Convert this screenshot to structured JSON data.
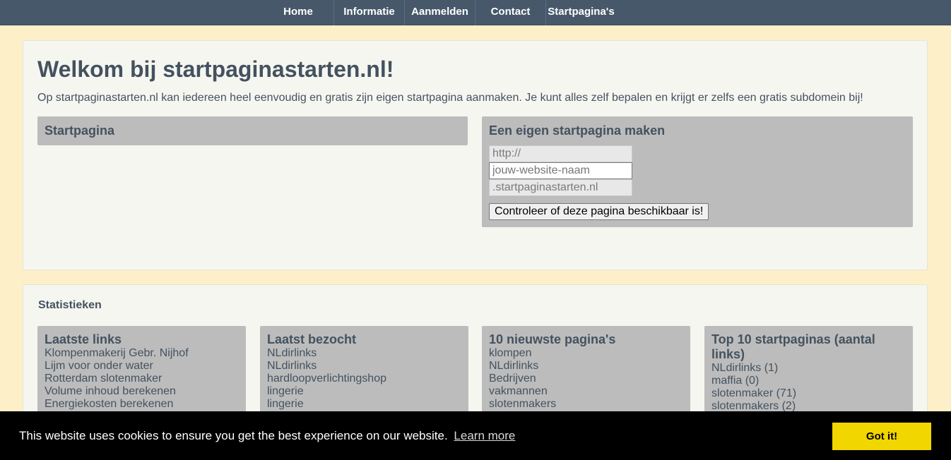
{
  "nav": {
    "items": [
      {
        "label": "Home"
      },
      {
        "label": "Informatie"
      },
      {
        "label": "Aanmelden"
      },
      {
        "label": "Contact"
      },
      {
        "label": "Startpagina's"
      }
    ]
  },
  "welcome": {
    "title": "Welkom bij startpaginastarten.nl!",
    "intro": "Op startpaginastarten.nl kan iedereen heel eenvoudig en gratis zijn eigen startpagina aanmaken. Je kunt alles zelf bepalen en krijgt er zelfs een gratis subdomein bij!"
  },
  "startpagina_box": {
    "title": "Startpagina"
  },
  "create_box": {
    "title": "Een eigen startpagina maken",
    "prefix_value": "http://",
    "name_placeholder": "jouw-website-naam",
    "suffix_value": ".startpaginastarten.nl",
    "check_button": "Controleer of deze pagina beschikbaar is!"
  },
  "stats": {
    "title": "Statistieken",
    "cards": [
      {
        "title": "Laatste links",
        "items": [
          "Klompenmakerij Gebr. Nijhof",
          "Lijm voor onder water",
          "Rotterdam slotenmaker",
          "Volume inhoud berekenen",
          "Energiekosten berekenen"
        ]
      },
      {
        "title": "Laatst bezocht",
        "items": [
          "NLdirlinks",
          "NLdirlinks",
          "hardloopverlichtingshop",
          "lingerie",
          "lingerie"
        ]
      },
      {
        "title": "10 nieuwste pagina's",
        "items": [
          "klompen",
          "NLdirlinks",
          "Bedrijven",
          "vakmannen",
          "slotenmakers"
        ]
      },
      {
        "title": "Top 10 startpaginas (aantal links)",
        "items": [
          "NLdirlinks (1)",
          "maffia (0)",
          "slotenmaker (71)",
          "slotenmakers (2)"
        ]
      }
    ]
  },
  "cookie": {
    "message": "This website uses cookies to ensure you get the best experience on our website.",
    "learn_more": "Learn more",
    "button": "Got it!",
    "button_color": "#f1d600"
  }
}
